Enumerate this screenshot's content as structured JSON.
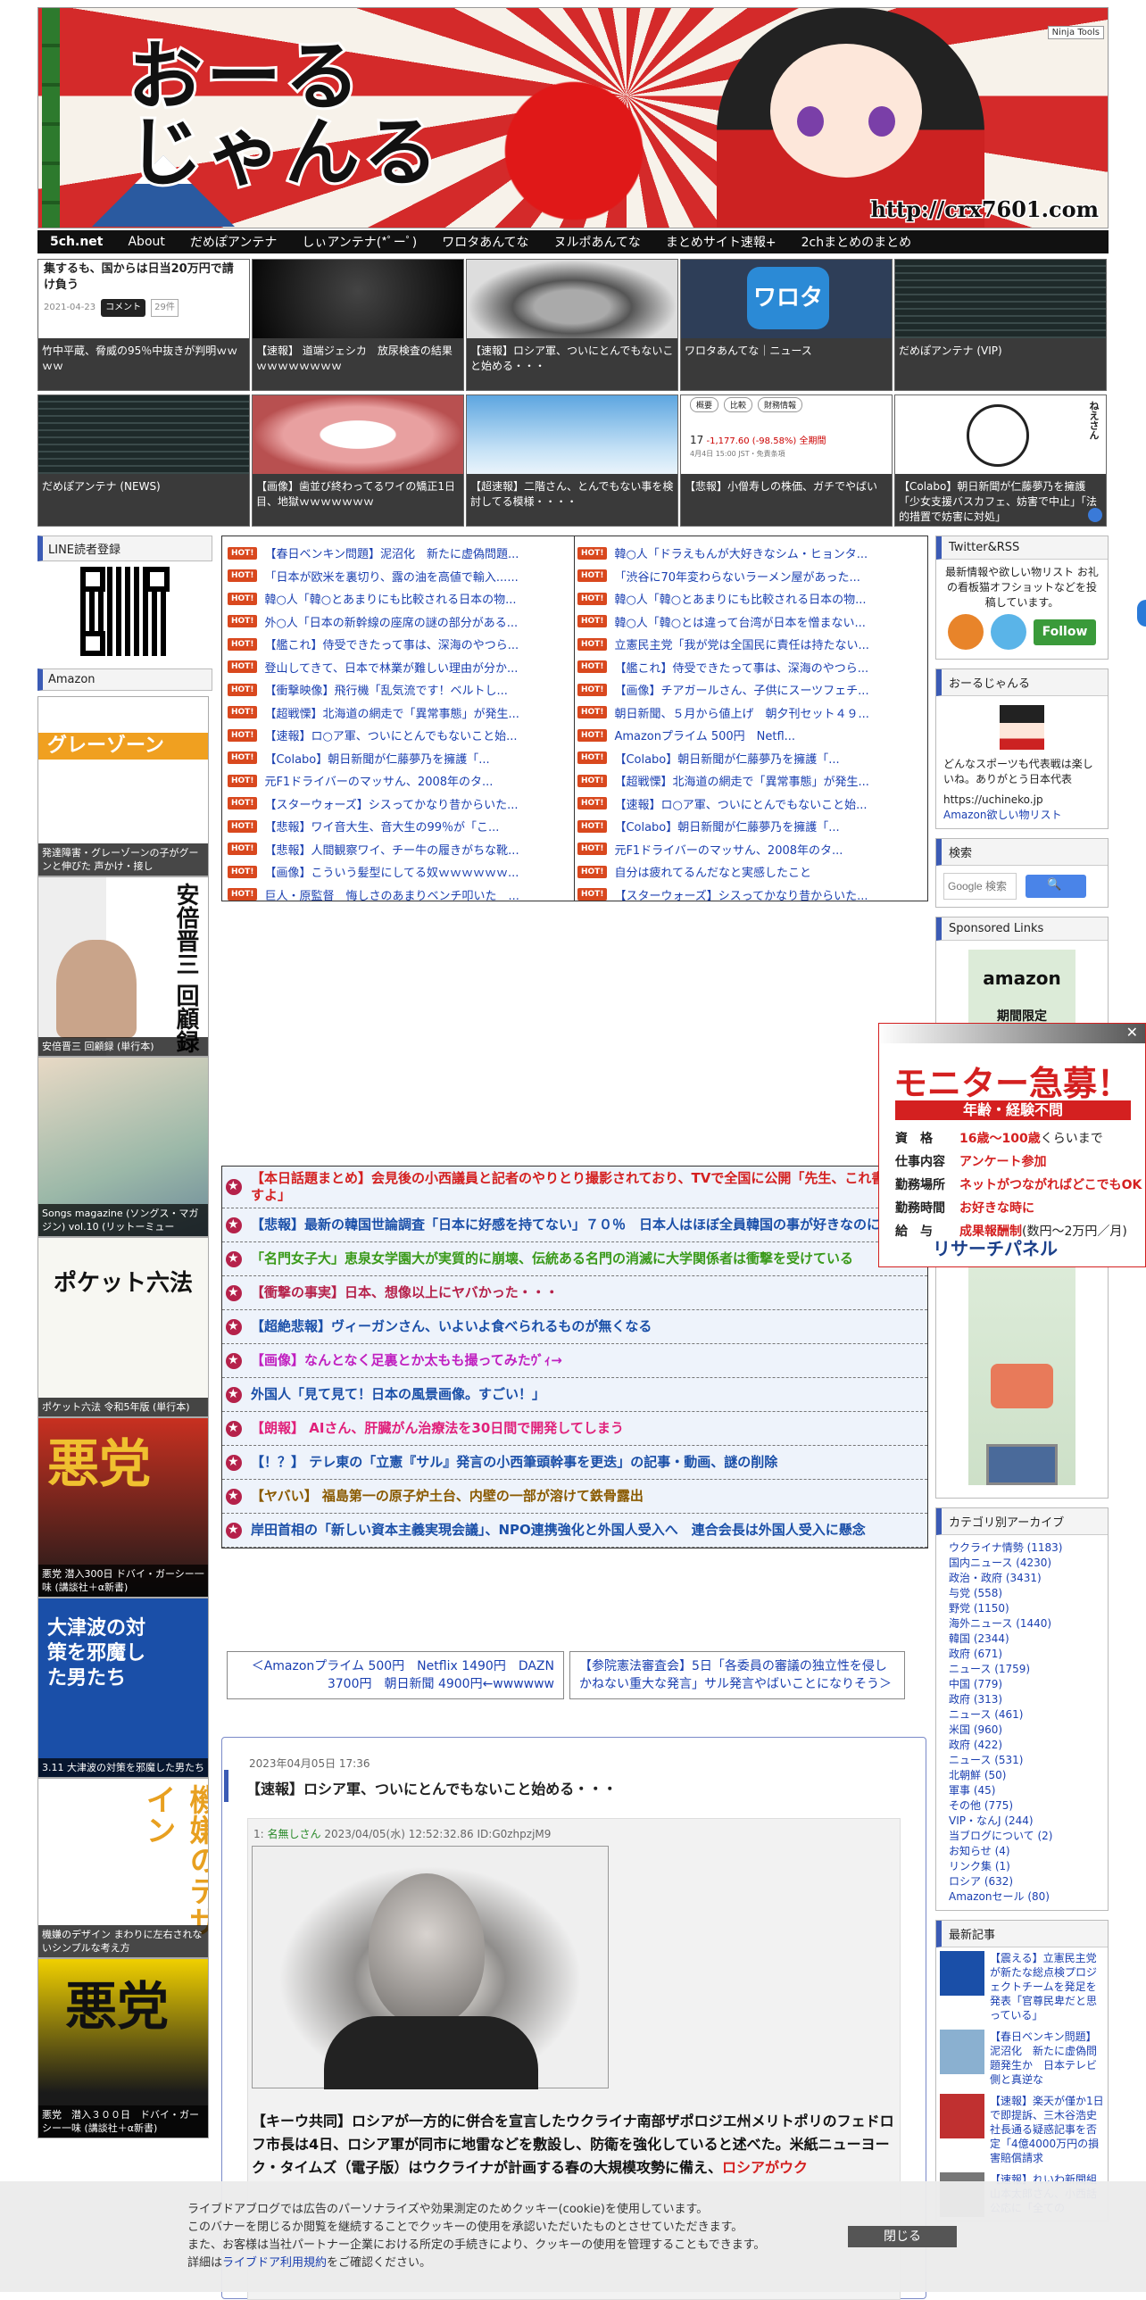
{
  "header": {
    "logo_line1": "おーる",
    "logo_line2": "じゃんる",
    "url_text": "http://crx7601.com",
    "ninja_label": "Ninja Tools"
  },
  "nav": [
    "5ch.net",
    "About",
    "だめぽアンテナ",
    "しぃアンテナ(*ﾟーﾟ)",
    "ワロタあんてな",
    "ヌルポあんてな",
    "まとめサイト速報+",
    "2chまとめのまとめ"
  ],
  "thumbs_row1": [
    {
      "cap": "竹中平蔵、脅威の95％中抜きが判明ｗｗｗｗ",
      "extra": "集するも、国からは日当20万円で請け負う",
      "date": "2021-04-23",
      "badge": "コメント",
      "count": "29件"
    },
    {
      "cap": "【速報】 道端ジェシカ　放尿検査の結果ｗｗｗｗｗｗｗｗ"
    },
    {
      "cap": "【速報】ロシア軍、ついにとんでもないこと始める・・・"
    },
    {
      "cap": "ワロタあんてな｜ニュース",
      "logo": "ワロタ"
    },
    {
      "cap": "だめぽアンテナ (VIP)"
    }
  ],
  "thumbs_row2": [
    {
      "cap": "だめぽアンテナ (NEWS)"
    },
    {
      "cap": "【画像】歯並び終わってるワイの矯正1日目、地獄ｗｗｗｗｗｗｗ"
    },
    {
      "cap": "【超速報】二階さん、とんでもない事を検討してる模様・・・・"
    },
    {
      "cap": "【悲報】小僧寿しの株価、ガチでやばい",
      "tabs": [
        "概要",
        "比較",
        "財務情報"
      ],
      "price": "17",
      "change": "-1,177.60 (-98.58%)",
      "trend": "全期間",
      "time": "4月4日 15:00 JST・免責条項"
    },
    {
      "cap": "【Colabo】朝日新聞が仁藤夢乃を擁護「少女支援バスカフェ、妨害で中止」「法的措置で妨害に対処」",
      "sign": "ねえさん"
    }
  ],
  "left": {
    "line_title": "LINE読者登録",
    "amazon_title": "Amazon",
    "books": [
      {
        "title": "発達障害・グレーゾーンの子がグーンと伸びた 声かけ・接し",
        "cover_text": "グレーゾーン"
      },
      {
        "title": "安倍晋三 回顧録 (単行本)",
        "cover_text": "安倍晋三 回顧録"
      },
      {
        "title": "Songs magazine (ソングス・マガジン) vol.10 (リットーミュー",
        "cover_text": ""
      },
      {
        "title": "ポケット六法 令和5年版 (単行本)",
        "cover_text": "ポケット六法"
      },
      {
        "title": "悪党 潜入300日 ドバイ・ガーシー一味 (講談社＋α新書)",
        "cover_text": "悪党"
      },
      {
        "title": "3.11 大津波の対策を邪魔した男たち",
        "cover_text": "大津波の対策を邪魔した男たち"
      },
      {
        "title": "機嫌のデザイン まわりに左右されないシンプルな考え方",
        "cover_text": "機嫌のデザイン"
      },
      {
        "title": "悪党　潜入３００日　ドバイ・ガーシー一味 (講談社＋α新書)",
        "cover_text": "悪党"
      }
    ]
  },
  "lists": {
    "hot_label": "HOT!",
    "left": [
      "【春日ベンキン問題】泥沼化　新たに虚偽問題...",
      "「日本が欧米を裏切り、露の油を高値で輸入......",
      "韓○人「韓○とあまりにも比較される日本の物...",
      "外○人「日本の新幹線の座席の謎の部分がある...",
      "【艦これ】侍受できたって事は、深海のやつら...",
      "登山してきて、日本で林業が難しい理由が分か...",
      "【衝撃映像】飛行機「乱気流です！ベルトし...",
      "【超戦慄】北海道の網走で「異常事態」が発生...",
      "【速報】ロ○ア軍、ついにとんでもないこと始...",
      "【Colabo】朝日新聞が仁藤夢乃を擁護「...",
      "元F1ドライバーのマッサん、2008年のタ...",
      "【スターウォーズ】シスってかなり昔からいた...",
      "【悲報】ワイ音大生、音大生の99％が「こ...",
      "【悲報】人間観察ワイ、チー牛の履きがちな靴...",
      "【画像】こういう髪型にしてる奴ｗｗｗｗｗｗ...",
      "巨人・原監督　悔しさのあまりベンチ叩いた　..."
    ],
    "right": [
      "韓○人「ドラえもんが大好きなシム・ヒョンタ...",
      "「渋谷に70年変わらないラーメン屋があった...",
      "韓○人「韓○とあまりにも比較される日本の物...",
      "韓○人「韓○とは違って台湾が日本を憎まない...",
      "立憲民主党「我が党は全国民に責任は持たない...",
      "【艦これ】侍受できたって事は、深海のやつら...",
      "【画像】チアガールさん、子供にスーツフェチ...",
      "朝日新聞、５月から値上げ　朝夕刊セット４９...",
      "Amazonプライム 500円　Netfl...",
      "【Colabo】朝日新聞が仁藤夢乃を擁護「...",
      "【超戦慄】北海道の網走で「異常事態」が発生...",
      "【速報】ロ○ア軍、ついにとんでもないこと始...",
      "【Colabo】朝日新聞が仁藤夢乃を擁護「...",
      "元F1ドライバーのマッサん、2008年のタ...",
      "自分は疲れてるんだなと実感したこと",
      "【スターウォーズ】シスってかなり昔からいた..."
    ]
  },
  "headlines": [
    {
      "text": "【本日話題まとめ】会見後の小西議員と記者のやりとり撮影されており、TVで全国に公開「先生、これ書きますよ」",
      "color": "#d42020"
    },
    {
      "text": "【悲報】最新の韓国世論調査「日本に好感を持てない」７０％　日本人はほぼ全員韓国の事が好きなのに",
      "color": "#1a4fa8"
    },
    {
      "text": "「名門女子大」恵泉女学園大が実質的に崩壊、伝統ある名門の消滅に大学関係者は衝撃を受けている",
      "color": "#3a9a1a"
    },
    {
      "text": "【衝撃の事実】日本、想像以上にヤバかった・・・",
      "color": "#b5214a"
    },
    {
      "text": "【超絶悲報】ヴィーガンさん、いよいよ食べられるものが無くなる",
      "color": "#1a4fa8"
    },
    {
      "text": "【画像】なんとなく足裏とか太もも撮ってみたｳﾞｨ→",
      "color": "#c020c0"
    },
    {
      "text": "外国人「見て見て！日本の風景画像。すごい！」",
      "color": "#1a4fa8"
    },
    {
      "text": "【朗報】 AIさん、肝臓がん治療法を30日間で開発してしまう",
      "color": "#e0207a"
    },
    {
      "text": "【！？】 テレ東の「立憲『サル』発言の小西筆頭幹事を更迭」の記事・動画、謎の削除",
      "color": "#1a4fa8"
    },
    {
      "text": "【ヤバい】 福島第一の原子炉土台、内壁の一部が溶けて鉄骨露出",
      "color": "#8a5a00"
    },
    {
      "text": "岸田首相の「新しい資本主義実現会議」、NPO連携強化と外国人受入へ　連合会長は外国人受入に懸念",
      "color": "#1a4fa8"
    }
  ],
  "pager": {
    "prev": "＜Amazonプライム 500円　Netflix 1490円　DAZN 3700円　朝日新聞 4900円←wwwwww",
    "next": "【参院憲法審査会】5日「各委員の審議の独立性を侵しかねない重大な発言」サル発言やばいことになりそう＞"
  },
  "article": {
    "date": "2023年04月05日 17:36",
    "title": "【速報】ロシア軍、ついにとんでもないこと始める・・・",
    "post_no": "1:",
    "poster": "名無しさん",
    "post_meta": "2023/04/05(水) 12:52:32.86 ID:G0zhpzjM9",
    "text_before": "【キーウ共同】ロシアが一方的に併合を宣言したウクライナ南部ザポロジエ州メリトポリのフェドロフ市長は4日、ロシア軍が同市に地雷などを敷設し、防衛を強化していると述べた。米紙ニューヨーク・タイムズ（電子版）はウクライナが計画する春の大規模攻勢に備え、",
    "text_red": "ロシアがウク"
  },
  "right": {
    "twitter_title": "Twitter&RSS",
    "twitter_text": "最新情報や欲しい物リスト お礼の看板猫オフショットなどを投稿しています。",
    "follow_label": "Follow",
    "profile_title": "おーるじゃんる",
    "profile_text": "どんなスポーツも代表戦は楽しいね。ありがとう日本代表",
    "profile_url": "https://uchineko.jp",
    "profile_link": "Amazon欲しい物リスト",
    "search_title": "検索",
    "search_placeholder": "Google 検索",
    "sponsored_title": "Sponsored Links",
    "sponsor_brand": "amazon",
    "sponsor_text": "期間限定",
    "category_title": "カテゴリ別アーカイブ",
    "categories": [
      "ウクライナ情勢 (1183)",
      "国内ニュース (4230)",
      "政治・政府 (3431)",
      "与党 (558)",
      "野党 (1150)",
      "海外ニュース (1440)",
      "韓国 (2344)",
      "政府 (671)",
      "ニュース (1759)",
      "中国 (779)",
      "政府 (313)",
      "ニュース (461)",
      "米国 (960)",
      "政府 (422)",
      "ニュース (531)",
      "北朝鮮 (50)",
      "軍事 (45)",
      "その他 (775)",
      "VIP・なんJ (244)",
      "当ブログについて (2)",
      "お知らせ (4)",
      "リンク集 (1)",
      "ロシア (632)",
      "Amazonセール (80)"
    ],
    "recent_title": "最新記事",
    "recent": [
      "【震える】立憲民主党が新たな総点検プロジェクトチームを発足を発表「官尊民卑だと思っている」",
      "【春日ベンキン問題】泥沼化　新たに虚偽問題発生か　日本テレビ側と真逆な",
      "【速報】楽天が僅か1日で即提訴、三木谷浩史社長通る疑惑記事を否定「4億4000万円の損害賠償請求",
      "【速報】れいわ新聞組山本太郎さん、小西話公応に「全ての"
    ]
  },
  "ad": {
    "headline": "モニター急募！",
    "sub": "年齢・経験不問",
    "rows": [
      {
        "k": "資　格",
        "v": "16歳～100歳",
        "rest": "くらいまで"
      },
      {
        "k": "仕事内容",
        "v": "アンケート参加",
        "rest": ""
      },
      {
        "k": "勤務場所",
        "v": "ネットがつながればどこでもOK",
        "rest": ""
      },
      {
        "k": "勤務時間",
        "v": "お好きな時に",
        "rest": ""
      },
      {
        "k": "給　与",
        "v": "成果報酬制",
        "rest": "(数円～2万円／月)"
      }
    ],
    "brand": "リサーチパネル",
    "close": "✕"
  },
  "cookie": {
    "line1": "ライブドアブログでは広告のパーソナライズや効果測定のためクッキー(cookie)を使用しています。",
    "line2": "このバナーを閉じるか閲覧を継続することでクッキーの使用を承認いただいたものとさせていただきます。",
    "line3": "また、お客様は当社パートナー企業における所定の手続きにより、クッキーの使用を管理することもできます。",
    "line4_pre": "詳細は",
    "line4_link": "ライブドア利用規約",
    "line4_post": "をご確認ください。",
    "close_label": "閉じる"
  },
  "colors": {
    "accent": "#3b5bb5",
    "hot": "#d9481e",
    "nav_bg": "#111111",
    "link": "#1a3fb0"
  }
}
